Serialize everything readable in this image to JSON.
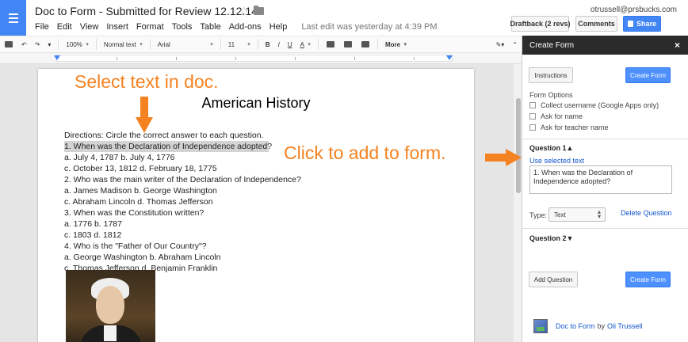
{
  "header": {
    "doc_title": "Doc to Form - Submitted for Review 12.12.14",
    "user_email": "otrussell@prsbucks.com",
    "menus": [
      "File",
      "Edit",
      "View",
      "Insert",
      "Format",
      "Tools",
      "Table",
      "Add-ons",
      "Help"
    ],
    "last_edit": "Last edit was yesterday at 4:39 PM",
    "draftback_label": "Draftback (2 revs)",
    "comments_label": "Comments",
    "share_label": "Share"
  },
  "toolbar": {
    "zoom": "100%",
    "style": "Normal text",
    "font": "Arial",
    "size": "11",
    "bold": "B",
    "italic": "I",
    "underline": "U",
    "text_color": "A",
    "more": "More"
  },
  "document": {
    "heading": "American History",
    "lines": [
      "Directions: Circle the correct answer to each question.",
      "1. When was the Declaration of Independence adopted?",
      "a. July 4, 1787 b. July 4, 1776",
      "c. October 13, 1812 d. February 18, 1775",
      "2. Who was the main writer of the Declaration of Independence?",
      "a. James Madison b. George Washington",
      "c. Abraham Lincoln d. Thomas Jefferson",
      "3. When was the Constitution written?",
      "a. 1776 b. 1787",
      "c. 1803 d. 1812",
      "4. Who is the \"Father of Our Country\"?",
      "a. George Washington b. Abraham Lincoln",
      "c. Thomas Jefferson d. Benjamin Franklin"
    ],
    "highlight_index": 1
  },
  "annotations": {
    "select_text": "Select text in doc.",
    "click_to_add": "Click to add to form.",
    "color": "#f58220"
  },
  "panel": {
    "title": "Create Form",
    "close": "×",
    "instructions_label": "Instructions",
    "create_form_label": "Create Form",
    "form_options_label": "Form Options",
    "options": [
      "Collect username (Google Apps only)",
      "Ask for name",
      "Ask for teacher name"
    ],
    "question1_title": "Question 1▲",
    "use_selected_label": "Use selected text",
    "question1_text": "1. When was the Declaration of Independence adopted?",
    "type_label": "Type:",
    "type_value": "Text",
    "delete_label": "Delete Question",
    "question2_title": "Question 2▼",
    "add_question_label": "Add Question",
    "footer_name": "Doc to Form",
    "footer_by": "by",
    "footer_author": "Oli Trussell"
  },
  "colors": {
    "brand_blue": "#4285f4",
    "action_blue": "#4d90fe",
    "panel_header": "#2b2b2b",
    "link": "#1155cc"
  }
}
